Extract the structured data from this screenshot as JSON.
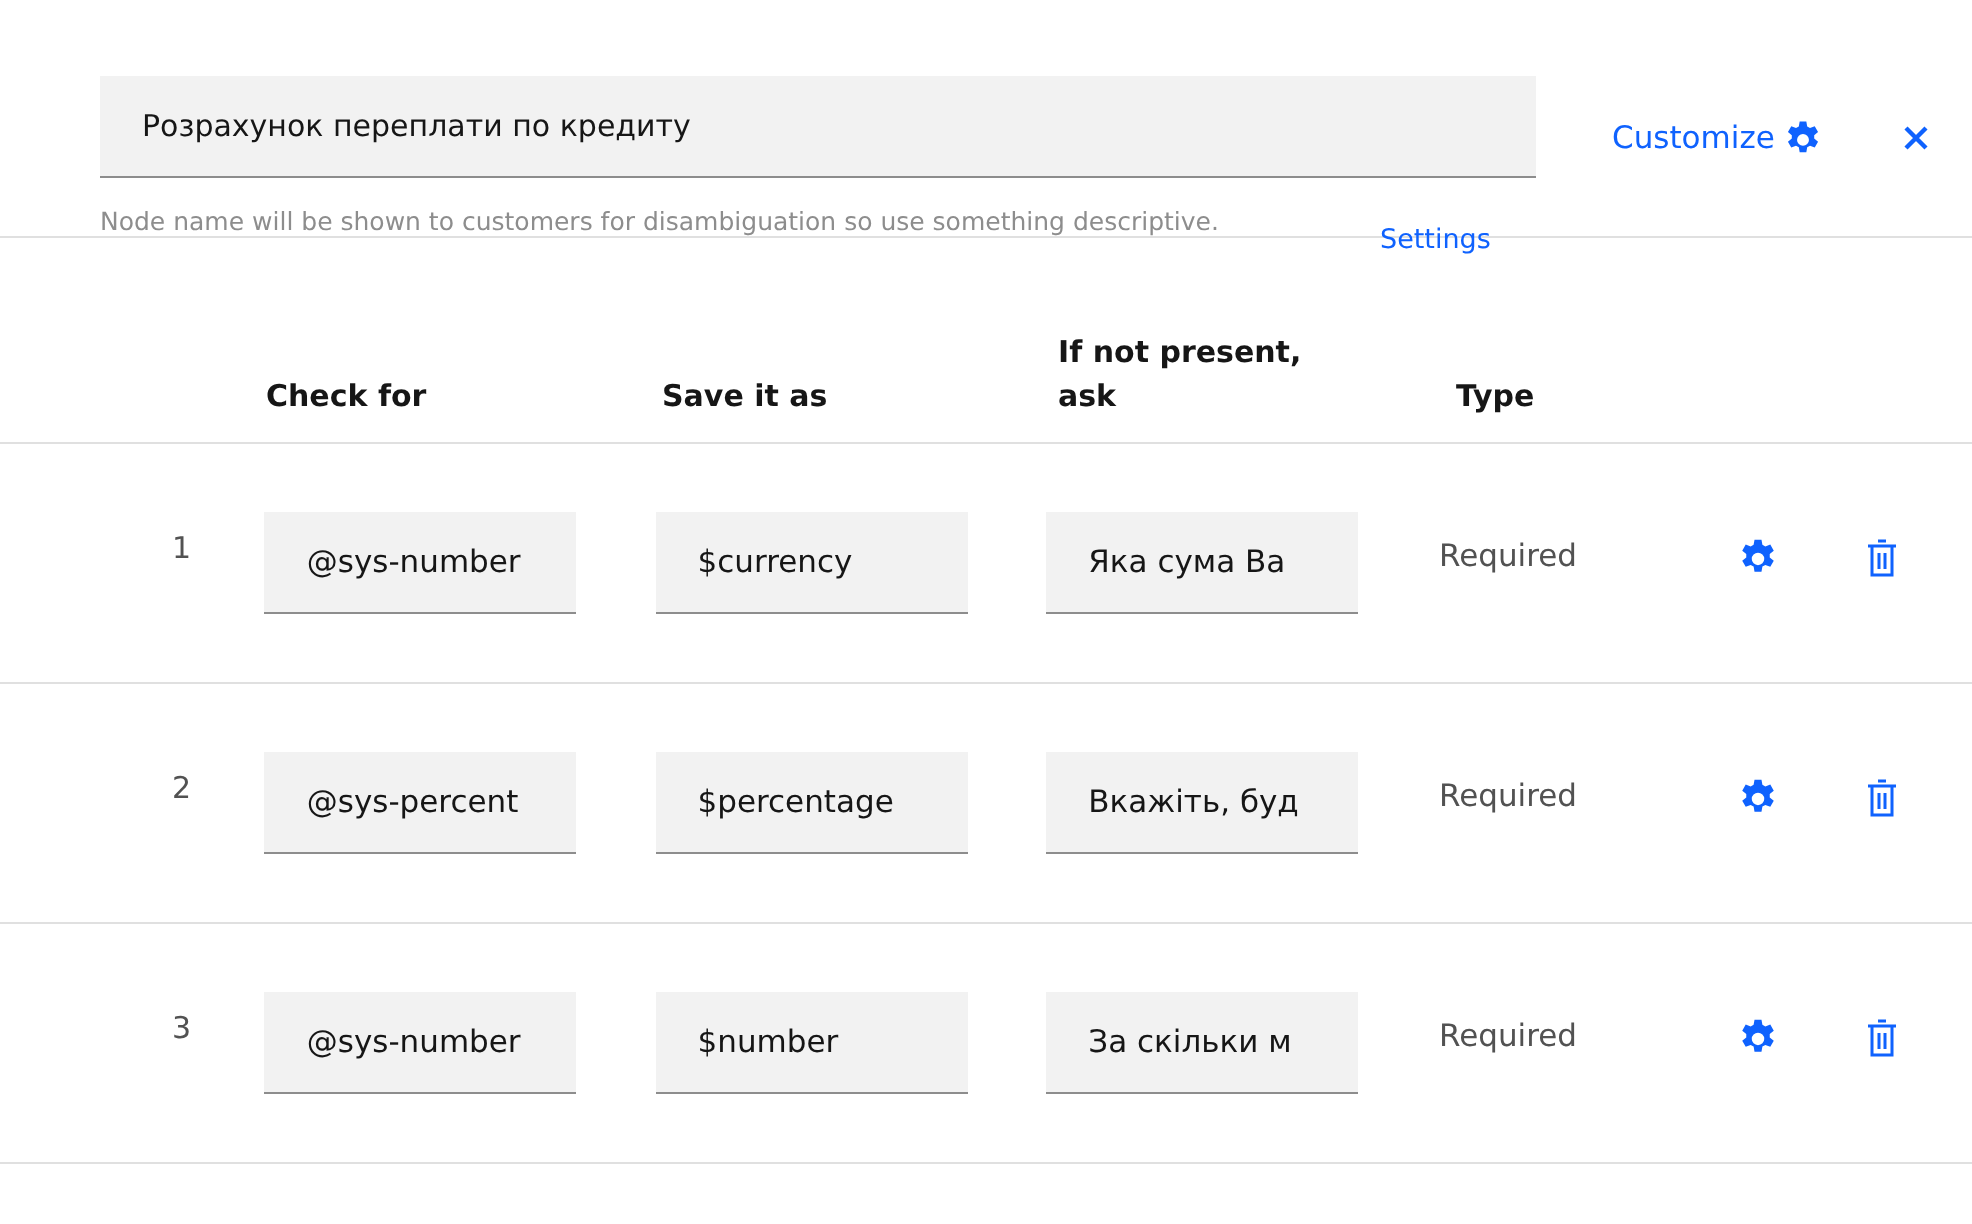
{
  "node_name": {
    "value": "Розрахунок переплати по кредиту",
    "hint": "Node name will be shown to customers for disambiguation so use something descriptive."
  },
  "customize_link": "Customize",
  "settings_link": "Settings",
  "columns": [
    "Check for",
    "Save it as",
    "If not present, ask",
    "Type"
  ],
  "slots": [
    {
      "number": "1",
      "check_for": "@sys-number",
      "save_as": "$currency",
      "prompt": "Яка сума Ва",
      "type": "Required"
    },
    {
      "number": "2",
      "check_for": "@sys-percent",
      "save_as": "$percentage",
      "prompt": "Вкажіть, буд",
      "type": "Required"
    },
    {
      "number": "3",
      "check_for": "@sys-number",
      "save_as": "$number",
      "prompt": "За скільки м",
      "type": "Required"
    }
  ]
}
